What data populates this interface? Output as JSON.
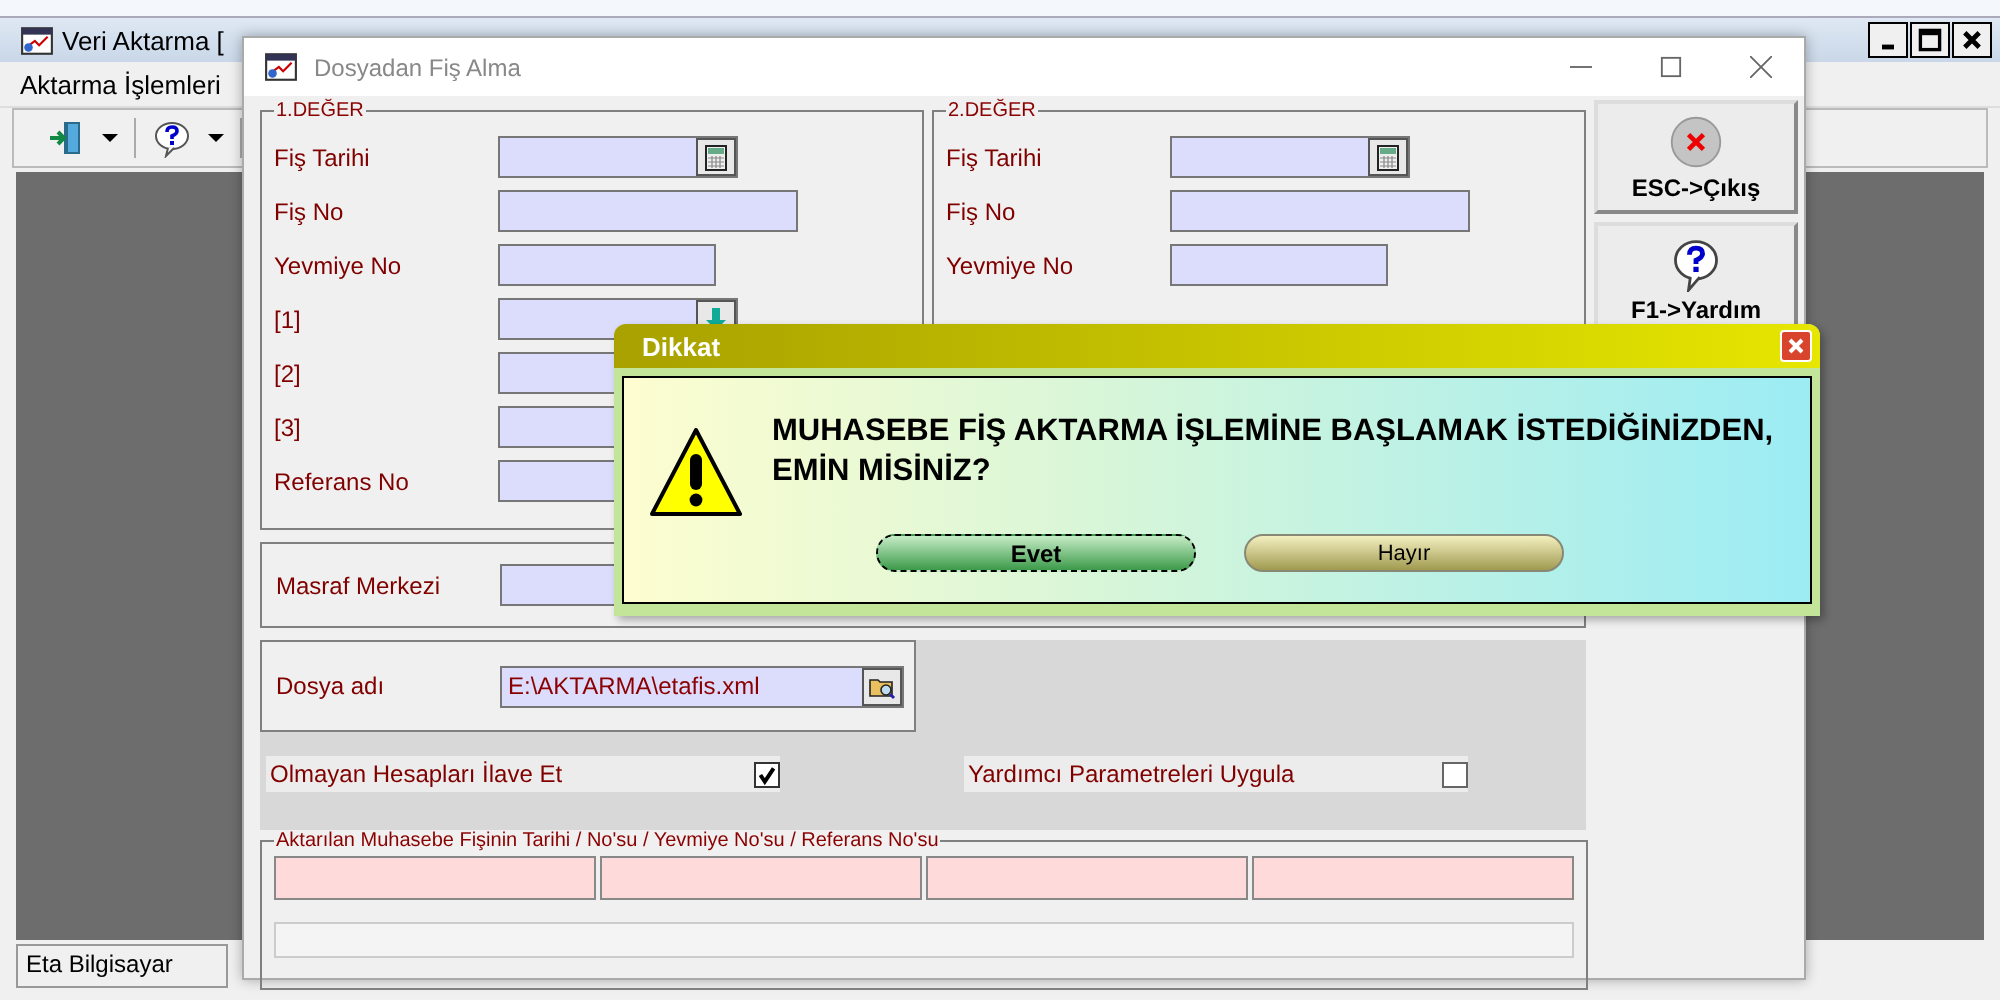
{
  "main_window": {
    "title": "Veri Aktarma [",
    "menu": [
      "Aktarma İşlemleri"
    ],
    "status_bar": [
      "Eta Bilgisayar"
    ]
  },
  "dialog": {
    "title": "Dosyadan Fiş Alma",
    "groups": [
      {
        "title": "1.DEĞER",
        "rows": [
          {
            "label": "Fiş Tarihi",
            "kind": "date"
          },
          {
            "label": "Fiş No",
            "kind": "long"
          },
          {
            "label": "Yevmiye No",
            "kind": "short"
          },
          {
            "label": "[1]",
            "kind": "lookup"
          },
          {
            "label": "[2]",
            "kind": "long"
          },
          {
            "label": "[3]",
            "kind": "long"
          },
          {
            "label": "Referans No",
            "kind": "long"
          }
        ]
      },
      {
        "title": "2.DEĞER",
        "rows": [
          {
            "label": "Fiş Tarihi",
            "kind": "date"
          },
          {
            "label": "Fiş No",
            "kind": "long"
          },
          {
            "label": "Yevmiye No",
            "kind": "short"
          }
        ]
      }
    ],
    "side_buttons": [
      {
        "label": "ESC->Çıkış",
        "kind": "exit"
      },
      {
        "label": "F1->Yardım",
        "kind": "help"
      }
    ],
    "cost_center": {
      "label": "Masraf Merkezi"
    },
    "file": {
      "label": "Dosya adı",
      "value": "E:\\AKTARMA\\etafis.xml"
    },
    "options": [
      {
        "label": "Olmayan Hesapları İlave Et",
        "checked": true
      },
      {
        "label": "Yardımcı Parametreleri Uygula",
        "checked": false
      }
    ],
    "result": {
      "title": "Aktarılan Muhasebe Fişinin Tarihi / No'su / Yevmiye No'su / Referans No'su"
    }
  },
  "alert": {
    "title": "Dikkat",
    "message_lines": [
      "MUHASEBE FİŞ AKTARMA İŞLEMİNE BAŞLAMAK İSTEDİĞİNİZDEN,",
      "EMİN MİSİNİZ?"
    ],
    "buttons": [
      {
        "label": "Evet",
        "focused": true
      },
      {
        "label": "Hayır",
        "focused": false
      }
    ]
  }
}
